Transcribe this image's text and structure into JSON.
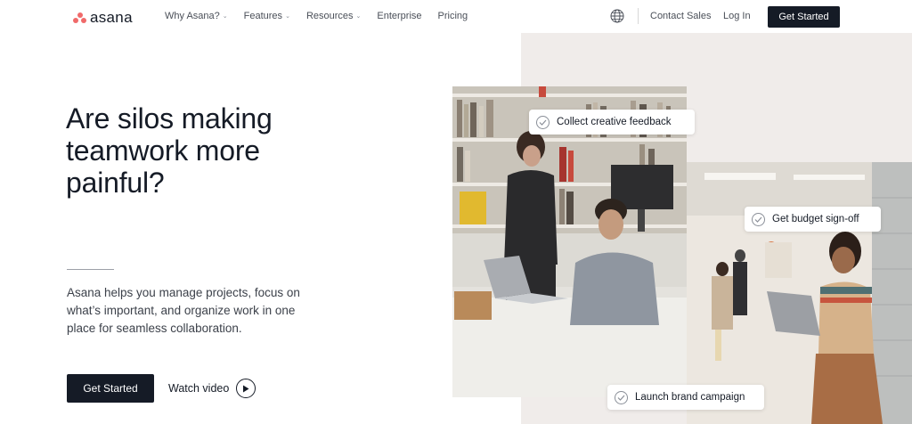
{
  "nav": {
    "logo_text": "asana",
    "links": [
      {
        "label": "Why Asana?",
        "has_dropdown": true
      },
      {
        "label": "Features",
        "has_dropdown": true
      },
      {
        "label": "Resources",
        "has_dropdown": true
      },
      {
        "label": "Enterprise",
        "has_dropdown": false
      },
      {
        "label": "Pricing",
        "has_dropdown": false
      }
    ],
    "globe_icon": "globe-icon",
    "contact_sales": "Contact Sales",
    "login": "Log In",
    "cta": "Get Started"
  },
  "hero": {
    "headline": "Are silos making teamwork more painful?",
    "subtext": "Asana helps you manage projects, focus on what’s important, and organize work in one place for seamless collaboration.",
    "cta_primary": "Get Started",
    "watch_video": "Watch video",
    "callouts": {
      "one": "Collect creative feedback",
      "two": "Get budget sign-off",
      "three": "Launch brand campaign"
    }
  },
  "colors": {
    "brand_coral": "#f06a6a",
    "dark": "#151b26",
    "panel_bg": "#f0ecea"
  }
}
